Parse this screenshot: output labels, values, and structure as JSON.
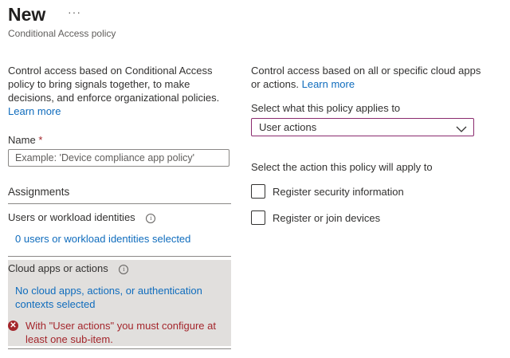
{
  "header": {
    "title": "New",
    "more_label": "···",
    "subtitle": "Conditional Access policy"
  },
  "left": {
    "description": "Control access based on Conditional Access policy to bring signals together, to make decisions, and enforce organizational policies.",
    "learn_more": "Learn more",
    "name_label": "Name",
    "required_mark": "*",
    "name_placeholder": "Example: 'Device compliance app policy'",
    "name_value": "",
    "assignments_heading": "Assignments",
    "users": {
      "label": "Users or workload identities",
      "info_icon": "info-icon",
      "link": "0 users or workload identities selected"
    },
    "cloud_apps": {
      "label": "Cloud apps or actions",
      "info_icon": "info-icon",
      "link": "No cloud apps, actions, or authentication contexts selected",
      "error_icon": "error-circle-icon",
      "error": "With \"User actions\" you must configure at least one sub-item."
    }
  },
  "right": {
    "description": "Control access based on all or specific cloud apps or actions.",
    "learn_more": "Learn more",
    "applies_label": "Select what this policy applies to",
    "applies_value": "User actions",
    "action_label": "Select the action this policy will apply to",
    "actions": [
      {
        "label": "Register security information",
        "checked": false
      },
      {
        "label": "Register or join devices",
        "checked": false
      }
    ]
  },
  "colors": {
    "link": "#0f6cbd",
    "error": "#a4262c",
    "selected_section_bg": "#e1dfdd",
    "dropdown_border": "#8a2a6e"
  }
}
